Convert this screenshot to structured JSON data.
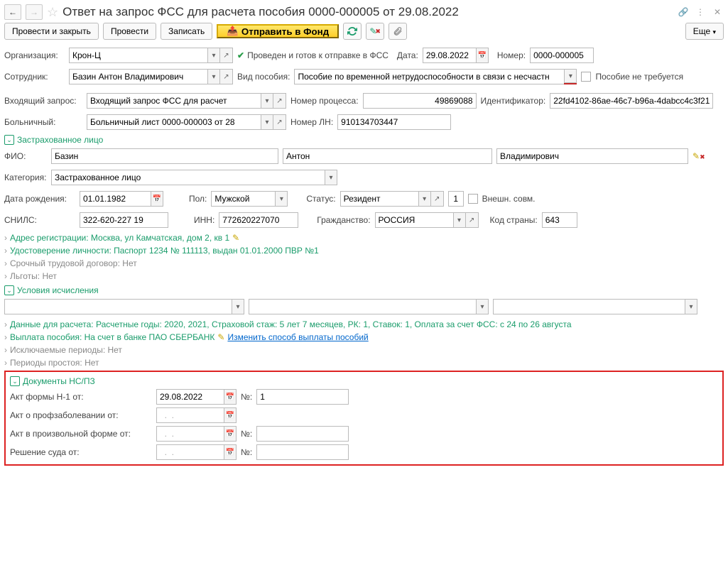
{
  "title": "Ответ на запрос ФСС для расчета пособия 0000-000005 от 29.08.2022",
  "toolbar": {
    "post_close": "Провести и закрыть",
    "post": "Провести",
    "write": "Записать",
    "send": "Отправить в Фонд",
    "more": "Еще"
  },
  "labels": {
    "org": "Организация:",
    "status": "Проведен и готов к отправке в ФСС",
    "date": "Дата:",
    "number": "Номер:",
    "employee": "Сотрудник:",
    "benefit_type": "Вид пособия:",
    "no_benefit": "Пособие не требуется",
    "incoming": "Входящий запрос:",
    "process_no": "Номер процесса:",
    "identifier": "Идентификатор:",
    "sick_list": "Больничный:",
    "ln_no": "Номер ЛН:",
    "insured": "Застрахованное лицо",
    "fio": "ФИО:",
    "category": "Категория:",
    "birth": "Дата рождения:",
    "sex": "Пол:",
    "status2": "Статус:",
    "external": "Внешн. совм.",
    "snils": "СНИЛС:",
    "inn": "ИНН:",
    "citizenship": "Гражданство:",
    "country_code": "Код страны:",
    "address": "Адрес регистрации: Москва, ул Камчатская, дом 2, кв 1",
    "identity": "Удостоверение личности: Паспорт 1234 № 111113, выдан 01.01.2000 ПВР №1",
    "urgent": "Срочный трудовой договор: Нет",
    "benefits": "Льготы: Нет",
    "calc_cond": "Условия исчисления",
    "calc_data": "Данные для расчета: Расчетные годы: 2020, 2021, Страховой стаж: 5 лет 7 месяцев, РК: 1, Ставок: 1, Оплата за счет ФСС: с 24 по 26 августа",
    "payout": "Выплата пособия: На счет в банке ПАО СБЕРБАНК",
    "change_payout": "Изменить способ выплаты пособий",
    "excluded": "Исключаемые периоды: Нет",
    "idle": "Периоды простоя: Нет",
    "docs": "Документы НС/ПЗ",
    "act_h1": "Акт формы Н-1 от:",
    "no": "№:",
    "act_prof": "Акт о профзаболевании от:",
    "act_free": "Акт в произвольной форме от:",
    "court": "Решение суда от:",
    "date_empty": "  .  .    "
  },
  "values": {
    "org": "Крон-Ц",
    "date": "29.08.2022",
    "number": "0000-000005",
    "employee": "Базин Антон Владимирович",
    "benefit_type": "Пособие по временной нетрудоспособности в связи с несчастн",
    "incoming": "Входящий запрос ФСС для расчет",
    "process_no": "49869088",
    "identifier": "22fd4102-86ae-46c7-b96a-4dabcc4c3f21",
    "sick_list": "Больничный лист 0000-000003 от 28",
    "ln_no": "910134703447",
    "surname": "Базин",
    "name": "Антон",
    "patronymic": "Владимирович",
    "category": "Застрахованное лицо",
    "birth": "01.01.1982",
    "sex": "Мужской",
    "status2": "Резидент",
    "one": "1",
    "snils": "322-620-227 19",
    "inn": "772620227070",
    "citizenship": "РОССИЯ",
    "country_code": "643",
    "act_h1_date": "29.08.2022",
    "act_h1_no": "1"
  }
}
